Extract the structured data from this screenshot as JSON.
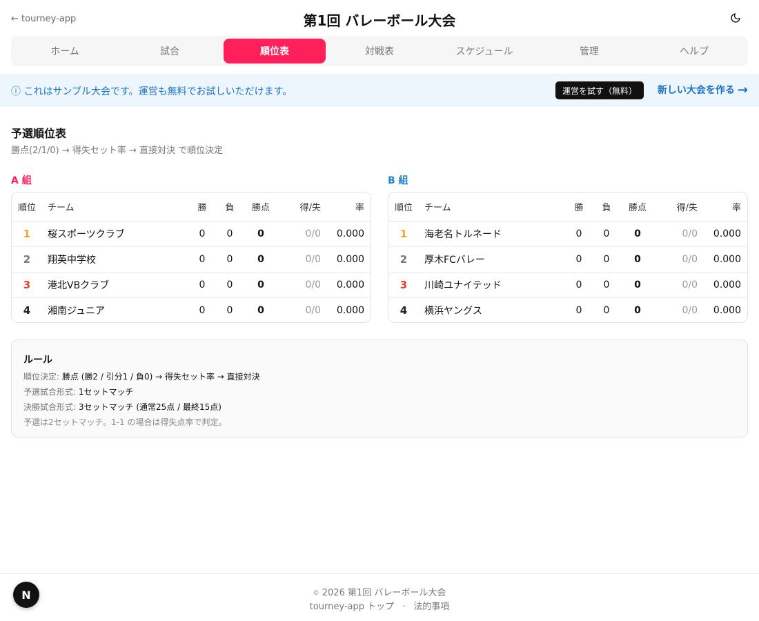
{
  "header": {
    "back_label": "← tourney-app",
    "title": "第1回 バレーボール大会",
    "theme_icon": "moon-icon"
  },
  "nav": {
    "tabs": [
      {
        "label": "ホーム",
        "active": false
      },
      {
        "label": "試合",
        "active": false
      },
      {
        "label": "順位表",
        "active": true
      },
      {
        "label": "対戦表",
        "active": false
      },
      {
        "label": "スケジュール",
        "active": false
      },
      {
        "label": "管理",
        "active": false
      },
      {
        "label": "ヘルプ",
        "active": false
      }
    ]
  },
  "banner": {
    "text": "ⓘ これはサンプル大会です。運営も無料でお試しいただけます。",
    "try_button": "運営を試す（無料）",
    "new_link": "新しい大会を作る",
    "new_link_arrow": "→"
  },
  "standings": {
    "title": "予選順位表",
    "subtitle": "勝点(2/1/0) → 得失セット率 → 直接対決 で順位決定",
    "columns": {
      "rank": "順位",
      "team": "チーム",
      "wins": "勝",
      "losses": "負",
      "points": "勝点",
      "sets": "得/失",
      "rate": "率"
    },
    "group_a": {
      "label": "A 組",
      "rows": [
        {
          "rank": "1",
          "team": "桜スポーツクラブ",
          "wins": "0",
          "losses": "0",
          "points": "0",
          "sets": "0/0",
          "rate": "0.000"
        },
        {
          "rank": "2",
          "team": "翔英中学校",
          "wins": "0",
          "losses": "0",
          "points": "0",
          "sets": "0/0",
          "rate": "0.000"
        },
        {
          "rank": "3",
          "team": "港北VBクラブ",
          "wins": "0",
          "losses": "0",
          "points": "0",
          "sets": "0/0",
          "rate": "0.000"
        },
        {
          "rank": "4",
          "team": "湘南ジュニア",
          "wins": "0",
          "losses": "0",
          "points": "0",
          "sets": "0/0",
          "rate": "0.000"
        }
      ]
    },
    "group_b": {
      "label": "B 組",
      "rows": [
        {
          "rank": "1",
          "team": "海老名トルネード",
          "wins": "0",
          "losses": "0",
          "points": "0",
          "sets": "0/0",
          "rate": "0.000"
        },
        {
          "rank": "2",
          "team": "厚木FCバレー",
          "wins": "0",
          "losses": "0",
          "points": "0",
          "sets": "0/0",
          "rate": "0.000"
        },
        {
          "rank": "3",
          "team": "川崎ユナイテッド",
          "wins": "0",
          "losses": "0",
          "points": "0",
          "sets": "0/0",
          "rate": "0.000"
        },
        {
          "rank": "4",
          "team": "横浜ヤングス",
          "wins": "0",
          "losses": "0",
          "points": "0",
          "sets": "0/0",
          "rate": "0.000"
        }
      ]
    }
  },
  "rules": {
    "title": "ルール",
    "ranking_key": "順位決定:",
    "ranking_value": "勝点 (勝2 / 引分1 / 負0) → 得失セット率 → 直接対決",
    "prelim_key": "予選試合形式:",
    "prelim_value": "1セットマッチ",
    "final_key": "決勝試合形式:",
    "final_value": "3セットマッチ (通常25点 / 最終15点)",
    "note": "予選は2セットマッチ。1-1 の場合は得失点率で判定。"
  },
  "footer": {
    "copyright_symbol": "©",
    "copyright": "2026 第1回 バレーボール大会",
    "top_link": "tourney-app トップ",
    "separator": "·",
    "legal_link": "法的事項"
  },
  "badge": {
    "letter": "N"
  },
  "colors": {
    "accent": "#ff1f5a",
    "info_blue": "#1a72c4",
    "rank_1": "#f5a623",
    "rank_2": "#777777",
    "rank_3": "#e0442a",
    "rank_4": "#222222"
  }
}
